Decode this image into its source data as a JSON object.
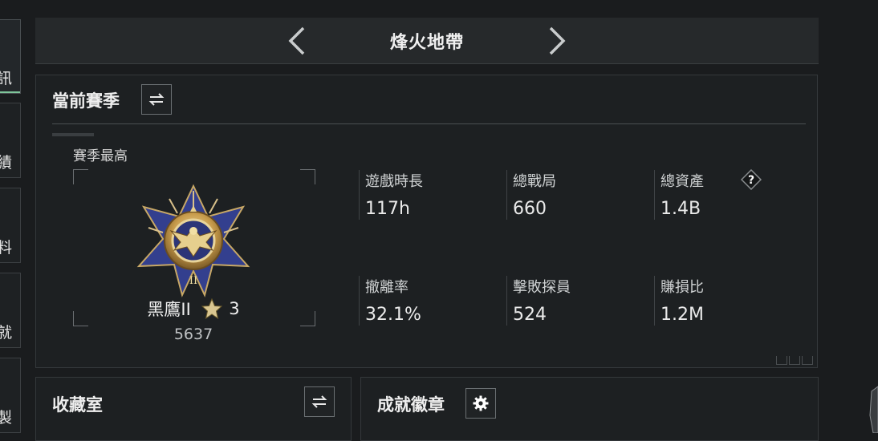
{
  "nav": {
    "tabs": [
      {
        "label": "訊",
        "active": true
      },
      {
        "label": "績",
        "active": false
      },
      {
        "label": "料",
        "active": false
      },
      {
        "label": "就",
        "active": false
      },
      {
        "label": "製",
        "active": false
      }
    ]
  },
  "header": {
    "title": "烽火地帶"
  },
  "season": {
    "title": "當前賽季",
    "best_label": "賽季最高",
    "rank": {
      "name": "黑鷹II",
      "stars": "3",
      "score": "5637"
    },
    "stats": [
      {
        "label": "遊戲時長",
        "value": "117h"
      },
      {
        "label": "總戰局",
        "value": "660"
      },
      {
        "label": "總資產",
        "value": "1.4B",
        "help": "?"
      },
      {
        "label": "撤離率",
        "value": "32.1%"
      },
      {
        "label": "擊敗探員",
        "value": "524"
      },
      {
        "label": "賺損比",
        "value": "1.2M"
      }
    ]
  },
  "collection": {
    "title": "收藏室"
  },
  "achievements": {
    "title": "成就徽章"
  },
  "colors": {
    "accent": "#7ec69a",
    "background": "#1a1c1e",
    "panel": "#1d2022"
  },
  "icons": {
    "switch": "swap-arrows-icon",
    "settings": "gear-icon",
    "prev": "chevron-left-icon",
    "next": "chevron-right-icon",
    "help": "question-diamond-icon",
    "star": "star-icon"
  }
}
